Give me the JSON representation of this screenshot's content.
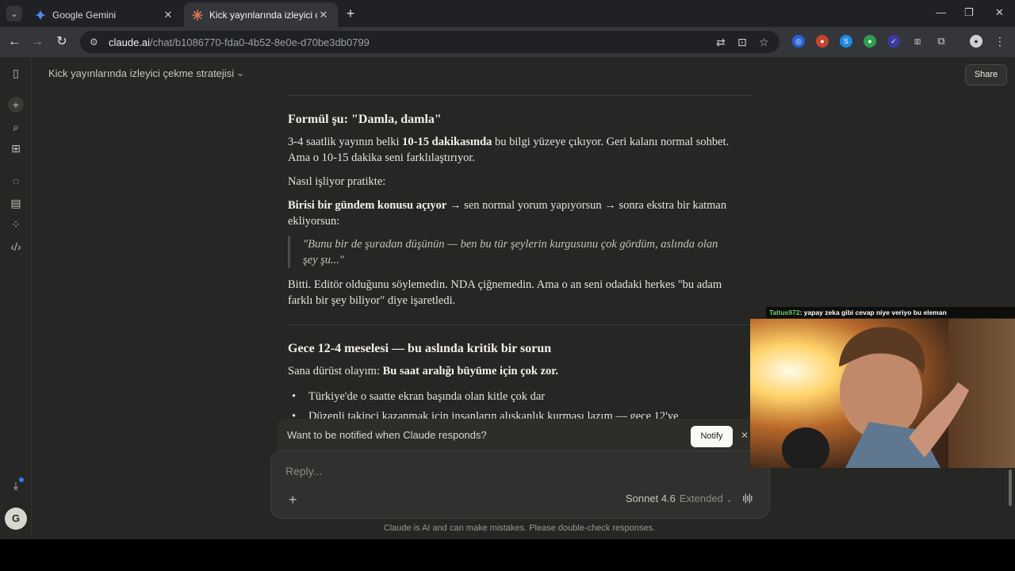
{
  "browser": {
    "tabs": [
      {
        "title": "Google Gemini",
        "icon": "gemini-icon",
        "active": false
      },
      {
        "title": "Kick yayınlarında izleyici çekme",
        "icon": "claude-icon",
        "active": true
      }
    ],
    "url_host": "claude.ai",
    "url_path": "/chat/b1086770-fda0-4b52-8e0e-d70be3db0799"
  },
  "header": {
    "conversation_title": "Kick yayınlarında izleyici çekme stratejisi",
    "share_label": "Share"
  },
  "article": {
    "section1_heading": "Formül şu: \"Damla, damla\"",
    "p1_a": "3-4 saatlik yayının belki ",
    "p1_b": "10-15 dakikasında",
    "p1_c": " bu bilgi yüzeye çıkıyor. Geri kalanı normal sohbet. Ama o 10-15 dakika seni farklılaştırıyor.",
    "p2": "Nasıl işliyor pratikte:",
    "p3_a": "Birisi bir gündem konusu açıyor",
    "p3_b": " → sen normal yorum yapıyorsun → sonra ekstra bir katman ekliyorsun:",
    "quote": "\"Bunu bir de şuradan düşünün — ben bu tür şeylerin kurgusunu çok gördüm, aslında olan şey şu...\"",
    "p4": "Bitti. Editör olduğunu söylemedin. NDA çiğnemedin. Ama o an seni odadaki herkes \"bu adam farklı bir şey biliyor\" diye işaretledi.",
    "section2_heading": "Gece 12-4 meselesi — bu aslında kritik bir sorun",
    "p5_a": "Sana dürüst olayım: ",
    "p5_b": "Bu saat aralığı büyüme için çok zor.",
    "bullets": [
      "Türkiye'de o saatte ekran başında olan kitle çok dar",
      "Düzenli takipçi kazanmak için insanların alışkanlık kurması lazım — gece 12'ye"
    ]
  },
  "notify": {
    "text": "Want to be notified when Claude responds?",
    "button": "Notify"
  },
  "composer": {
    "placeholder": "Reply...",
    "model": "Sonnet 4.6",
    "mode": "Extended",
    "disclaimer": "Claude is AI and can make mistakes. Please double-check responses."
  },
  "stream": {
    "chat_user": "Taltus972",
    "chat_message": ": yapay zeka gibi cevap niye veriyo bu eleman"
  },
  "colors": {
    "app_bg": "#262624",
    "accent": "#d97757",
    "chat_user": "#6fd16f"
  }
}
